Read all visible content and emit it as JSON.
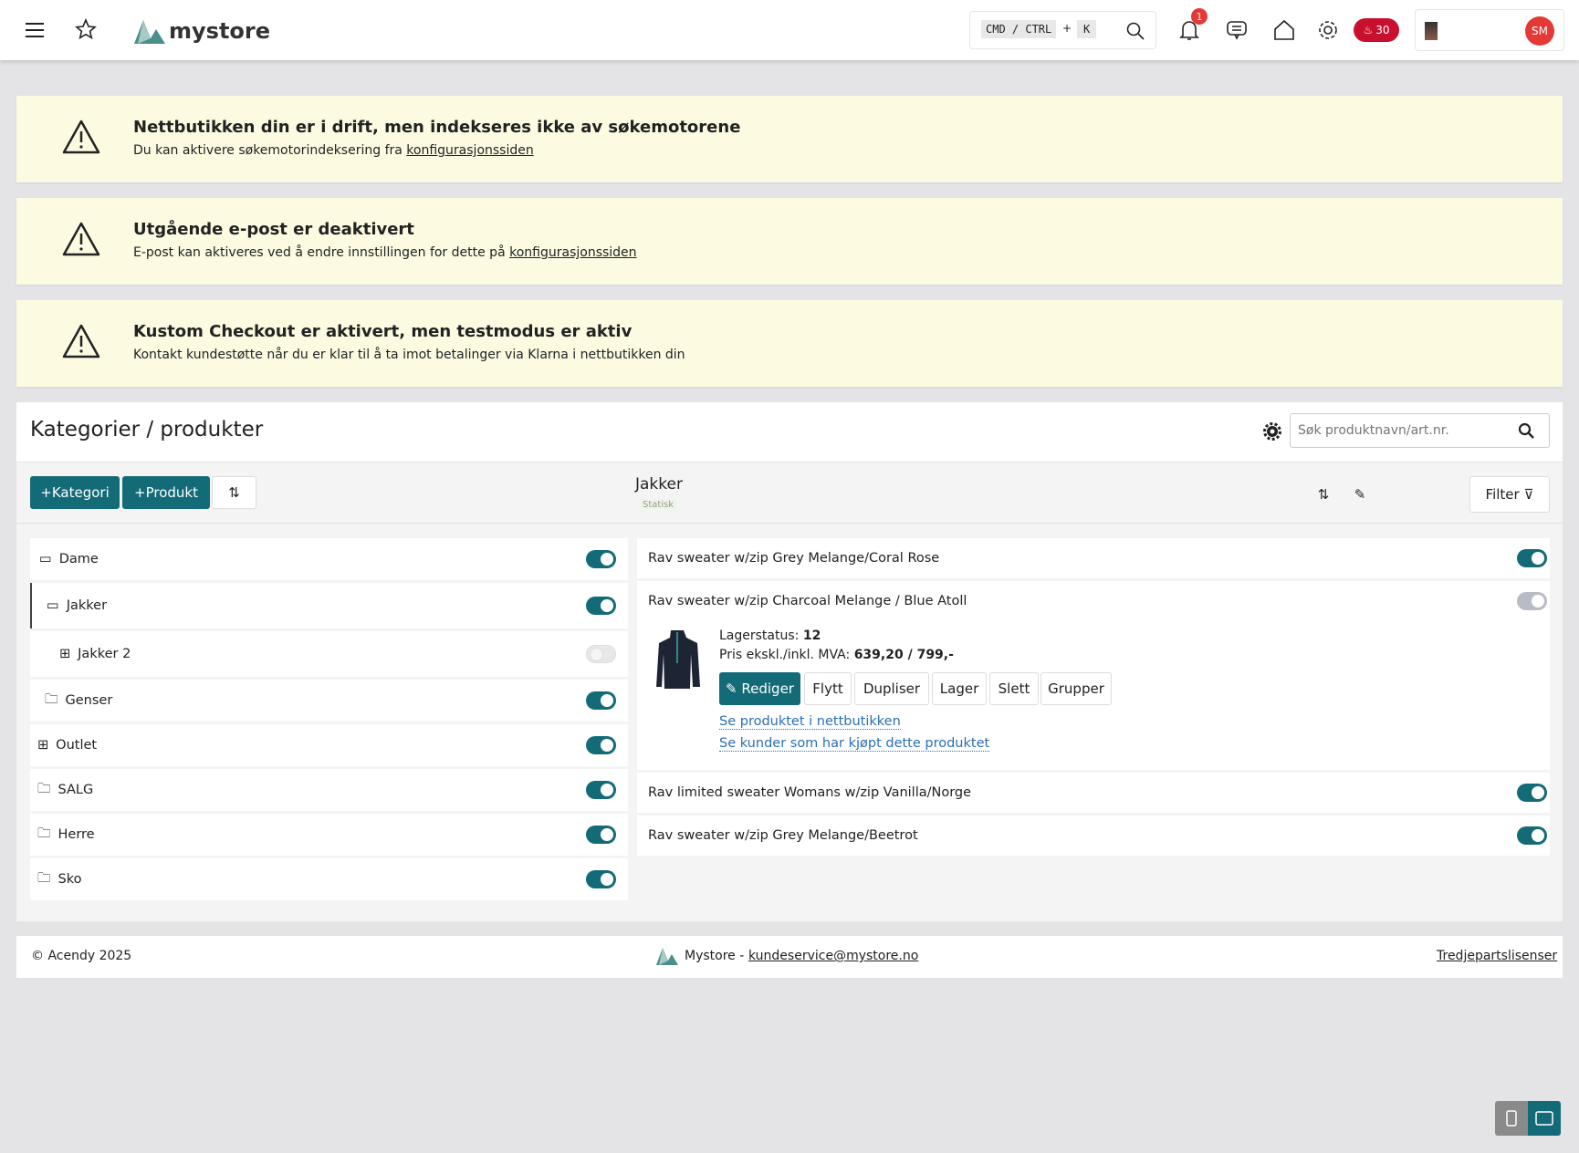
{
  "header": {
    "brand": "mystore",
    "shortcut_cmd": "CMD / CTRL",
    "shortcut_plus": "+",
    "shortcut_key": "K",
    "notification_count": "1",
    "points_badge": "30",
    "avatar_initials": "SM"
  },
  "banners": [
    {
      "title": "Nettbutikken din er i drift, men indekseres ikke av søkemotorene",
      "text": "Du kan aktivere søkemotorindeksering fra ",
      "link": "konfigurasjonssiden"
    },
    {
      "title": "Utgående e-post er deaktivert",
      "text": "E-post kan aktiveres ved å endre innstillingen for dette på ",
      "link": "konfigurasjonssiden"
    },
    {
      "title": "Kustom Checkout er aktivert, men testmodus er aktiv",
      "text": "Kontakt kundestøtte når du er klar til å ta imot betalinger via Klarna i nettbutikken din",
      "link": ""
    }
  ],
  "main": {
    "title": "Kategorier / produkter",
    "search_placeholder": "Søk produktnavn/art.nr.",
    "add_category": "Kategori",
    "add_product": "Produkt",
    "plus": "+",
    "current_category": "Jakker",
    "category_type": "Statisk",
    "filter": "Filter"
  },
  "categories": [
    {
      "name": "Dame",
      "on": true
    },
    {
      "name": "Jakker",
      "on": true
    },
    {
      "name": "Jakker 2",
      "on": false
    },
    {
      "name": "Genser",
      "on": true
    },
    {
      "name": "Outlet",
      "on": true
    },
    {
      "name": "SALG",
      "on": true
    },
    {
      "name": "Herre",
      "on": true
    },
    {
      "name": "Sko",
      "on": true
    }
  ],
  "products": [
    {
      "name": "Rav sweater w/zip Grey Melange/Coral Rose",
      "on": true
    },
    {
      "name": "Rav sweater w/zip Charcoal Melange / Blue Atoll",
      "on": false
    },
    {
      "name": "Rav limited sweater Womans w/zip Vanilla/Norge",
      "on": true
    },
    {
      "name": "Rav sweater w/zip Grey Melange/Beetrot",
      "on": true
    }
  ],
  "detail": {
    "stock_label": "Lagerstatus: ",
    "stock": "12",
    "price_label": "Pris ekskl./inkl. MVA: ",
    "price": "639,20 / 799,-",
    "actions": [
      "Rediger",
      "Flytt",
      "Dupliser",
      "Lager",
      "Slett",
      "Grupper"
    ],
    "link1": "Se produktet i nettbutikken",
    "link2": "Se kunder som har kjøpt dette produktet"
  },
  "footer": {
    "copyright": "© Acendy 2025",
    "store": "Mystore - ",
    "email": "kundeservice@mystore.no",
    "licenses": "Tredjepartslisenser"
  },
  "colors": {
    "primary": "#146b78",
    "banner": "#fcfbe2",
    "badge": "#c8102e"
  }
}
